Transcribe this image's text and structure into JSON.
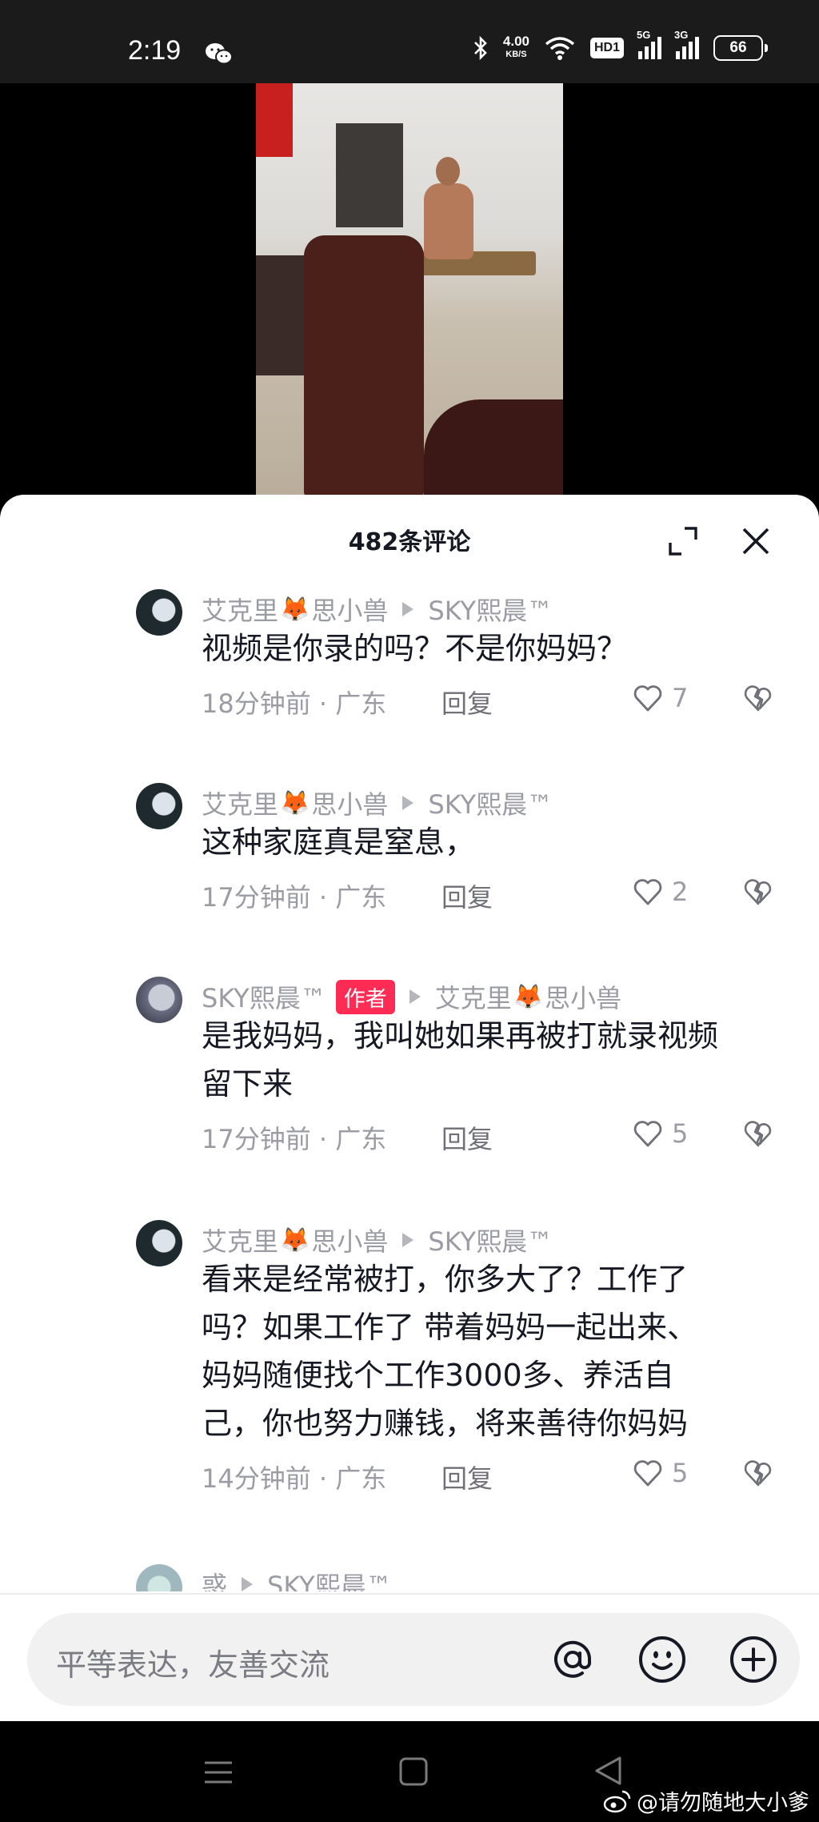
{
  "status_bar": {
    "time": "2:19",
    "net_speed_value": "4.00",
    "net_speed_unit": "KB/S",
    "hd_label": "HD1",
    "sim1_label": "5G",
    "sim2_label": "3G",
    "battery": "66"
  },
  "comments_panel": {
    "title": "482条评论",
    "comments": [
      {
        "user": "艾克里",
        "user_suffix": "思小兽",
        "reply_to": "SKY熙晨™",
        "text": "视频是你录的吗？不是你妈妈？",
        "time_location": "18分钟前 · 广东",
        "reply_label": "回复",
        "likes": "7"
      },
      {
        "user": "艾克里",
        "user_suffix": "思小兽",
        "reply_to": "SKY熙晨™",
        "text": "这种家庭真是窒息，",
        "time_location": "17分钟前 · 广东",
        "reply_label": "回复",
        "likes": "2"
      },
      {
        "user": "SKY熙晨™",
        "badge": "作者",
        "reply_to": "艾克里",
        "reply_to_suffix": "思小兽",
        "text_line1": "是我妈妈，我叫她如果再被打就录视频",
        "text_line2": "留下来",
        "time_location": "17分钟前 · 广东",
        "reply_label": "回复",
        "likes": "5"
      },
      {
        "user": "艾克里",
        "user_suffix": "思小兽",
        "reply_to": "SKY熙晨™",
        "text_line1": "看来是经常被打，你多大了？工作了",
        "text_line2": "吗？如果工作了 带着妈妈一起出来、",
        "text_line3": "妈妈随便找个工作3000多、养活自",
        "text_line4": "己，你也努力赚钱，将来善待你妈妈",
        "time_location": "14分钟前 · 广东",
        "reply_label": "回复",
        "likes": "5"
      },
      {
        "user": "惑",
        "reply_to": "SKY熙晨™"
      }
    ]
  },
  "input": {
    "placeholder": "平等表达，友善交流"
  },
  "watermark": "@请勿随地大小爹"
}
